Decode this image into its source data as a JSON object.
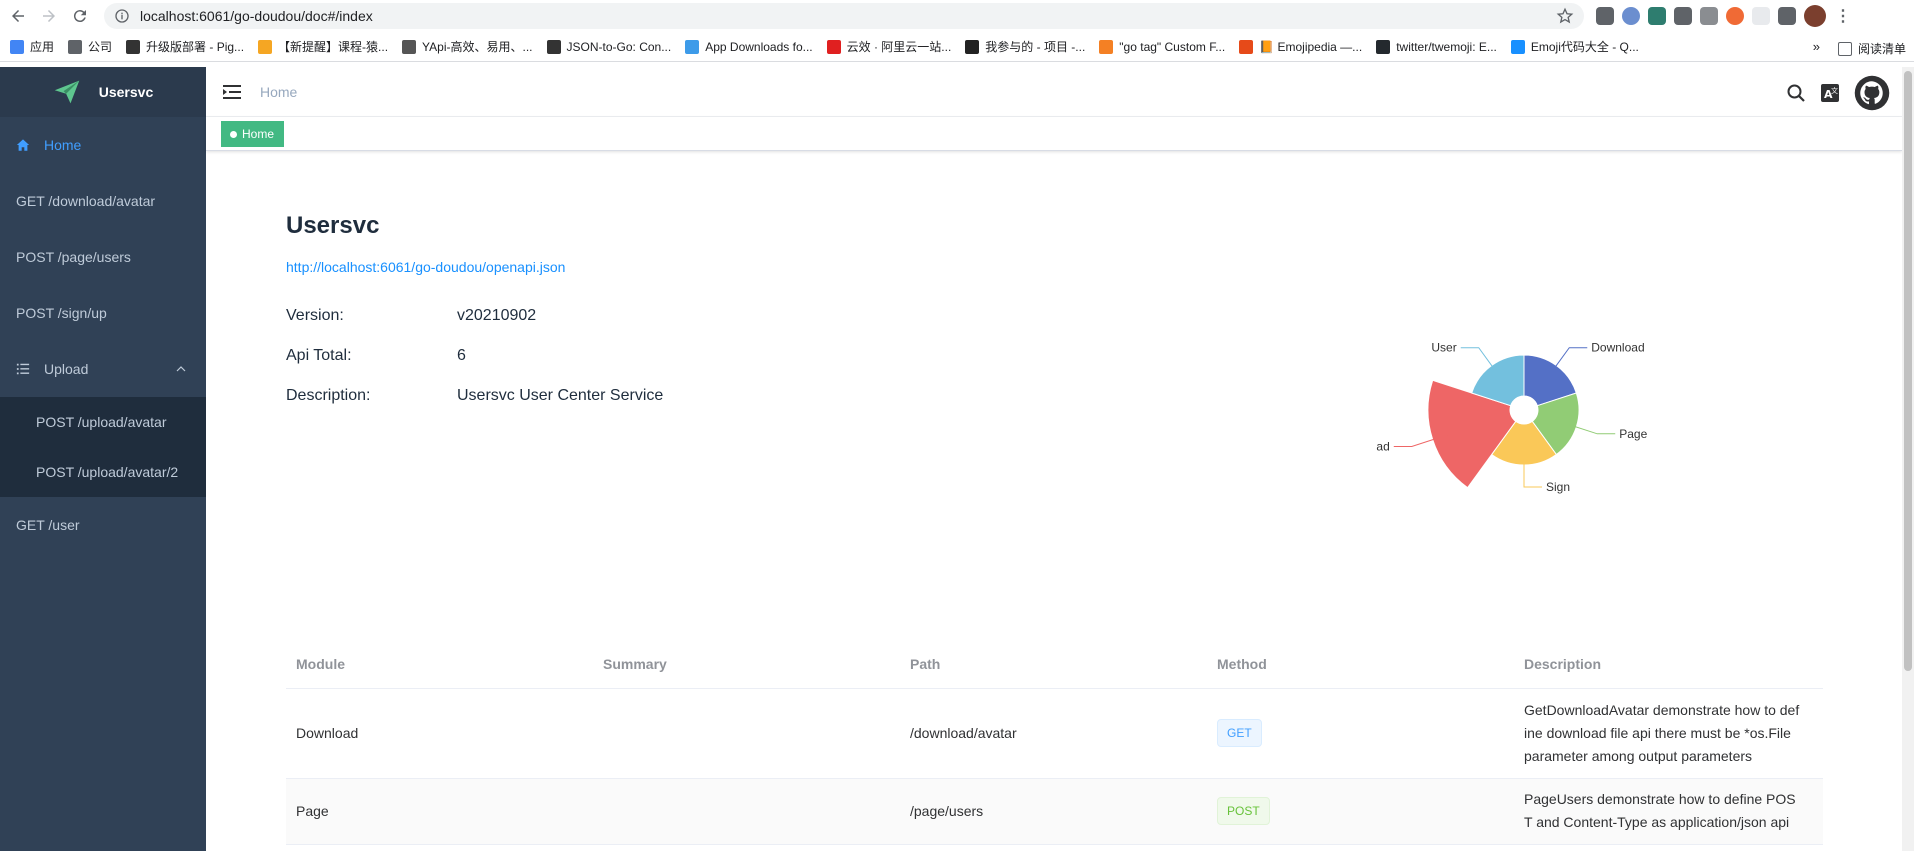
{
  "browser": {
    "url": "localhost:6061/go-doudou/doc#/index",
    "bookmarks": [
      {
        "label": "应用",
        "color": "#4285f4"
      },
      {
        "label": "公司",
        "color": "#5f6368"
      },
      {
        "label": "升级版部署 - Pig...",
        "color": "#333333"
      },
      {
        "label": "【新提醒】课程-猿...",
        "color": "#f5a623"
      },
      {
        "label": "YApi-高效、易用、...",
        "color": "#555555"
      },
      {
        "label": "JSON-to-Go: Con...",
        "color": "#333333"
      },
      {
        "label": "App Downloads fo...",
        "color": "#3d9be9"
      },
      {
        "label": "云效 · 阿里云一站...",
        "color": "#e02020"
      },
      {
        "label": "我参与的 - 项目 -...",
        "color": "#222222"
      },
      {
        "label": "\"go tag\" Custom F...",
        "color": "#f48024"
      },
      {
        "label": "📙 Emojipedia —...",
        "color": "#e64a19"
      },
      {
        "label": "twitter/twemoji: E...",
        "color": "#24292e"
      },
      {
        "label": "Emoji代码大全 - Q...",
        "color": "#1890ff"
      }
    ],
    "more": "»",
    "reading_list": "阅读清单"
  },
  "sidebar": {
    "app_title": "Usersvc",
    "items": [
      {
        "label": "Home",
        "icon": "home-icon",
        "active": true
      },
      {
        "label": "GET /download/avatar"
      },
      {
        "label": "POST /page/users"
      },
      {
        "label": "POST /sign/up"
      },
      {
        "label": "Upload",
        "icon": "list-icon",
        "expanded": true
      }
    ],
    "upload_children": [
      "POST /upload/avatar",
      "POST /upload/avatar/2"
    ],
    "last_item": "GET /user"
  },
  "navbar": {
    "breadcrumb": "Home"
  },
  "tags": {
    "home": "Home"
  },
  "main": {
    "title": "Usersvc",
    "spec_link": "http://localhost:6061/go-doudou/openapi.json",
    "info": [
      {
        "label": "Version:",
        "value": "v20210902"
      },
      {
        "label": "Api Total:",
        "value": "6"
      },
      {
        "label": "Description:",
        "value": "Usersvc User Center Service"
      }
    ]
  },
  "chart_data": {
    "type": "pie",
    "variant": "rose",
    "categories": [
      "Download",
      "Page",
      "Sign",
      "Upload",
      "User"
    ],
    "values": [
      1,
      1,
      1,
      2,
      1
    ],
    "colors": [
      "#5470c6",
      "#91cc75",
      "#fac858",
      "#ee6666",
      "#73c0de"
    ]
  },
  "table": {
    "headers": [
      "Module",
      "Summary",
      "Path",
      "Method",
      "Description"
    ],
    "rows": [
      {
        "module": "Download",
        "summary": "",
        "path": "/download/avatar",
        "method": "GET",
        "description": "GetDownloadAvatar demonstrate how to def ine download file api there must be *os.File parameter among output parameters"
      },
      {
        "module": "Page",
        "summary": "",
        "path": "/page/users",
        "method": "POST",
        "description": "PageUsers demonstrate how to define POS T and Content-Type as application/json api"
      }
    ]
  }
}
